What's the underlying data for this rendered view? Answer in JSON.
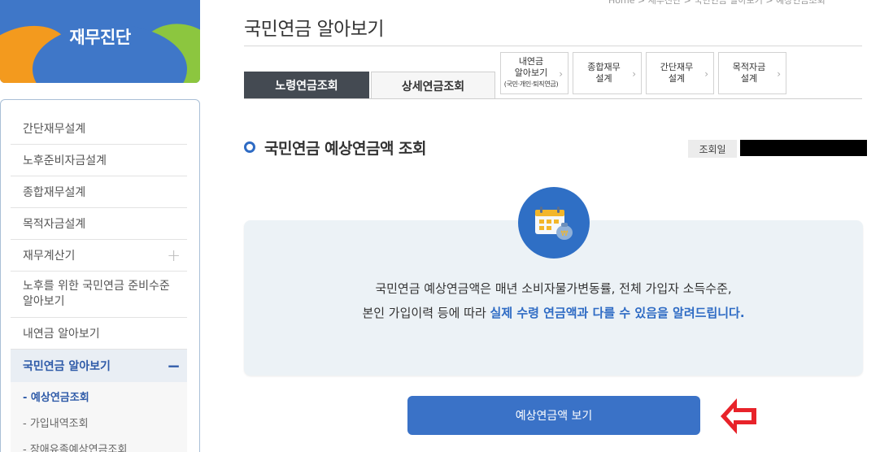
{
  "sidebar": {
    "title": "재무진단",
    "items": [
      {
        "label": "간단재무설계"
      },
      {
        "label": "노후준비자금설계"
      },
      {
        "label": "종합재무설계"
      },
      {
        "label": "목적자금설계"
      },
      {
        "label": "재무계산기",
        "expander": "+"
      },
      {
        "label": "노후를 위한 국민연금 준비수준 알아보기"
      },
      {
        "label": "내연금 알아보기"
      },
      {
        "label": "국민연금 알아보기",
        "expander": "−"
      }
    ],
    "sub_items": [
      {
        "label": "- 예상연금조회"
      },
      {
        "label": "- 가입내역조회"
      },
      {
        "label": "- 장애유족예상연금조회"
      }
    ]
  },
  "breadcrumb": "Home > 재무진단 > 국민연금 알아보기 > 예상연금조회",
  "page_title": "국민연금 알아보기",
  "tabs": {
    "tab1": "노령연금조회",
    "tab2": "상세연금조회"
  },
  "small_tabs": {
    "t1_line1": "내연금",
    "t1_line2": "알아보기",
    "t1_line3": "(국민·개인·퇴직연금)",
    "t2_line1": "종합재무",
    "t2_line2": "설계",
    "t3_line1": "간단재무",
    "t3_line2": "설계",
    "t4_line1": "목적자금",
    "t4_line2": "설계",
    "chevron": "›"
  },
  "section": {
    "title": "국민연금 예상연금액 조회",
    "date_label": "조회일"
  },
  "info": {
    "line1": "국민연금 예상연금액은 매년 소비자물가변동률, 전체 가입자 소득수준,",
    "line2_prefix": "본인 가입이력 등에 따라 ",
    "line2_highlight": "실제 수령 연금액과 다를 수 있음을 알려드립니다."
  },
  "button": {
    "label": "예상연금액 보기"
  },
  "colors": {
    "primary": "#3a72c7",
    "dark_tab": "#444a52",
    "highlight": "#2e6bc4",
    "arrow": "#e8232a"
  }
}
